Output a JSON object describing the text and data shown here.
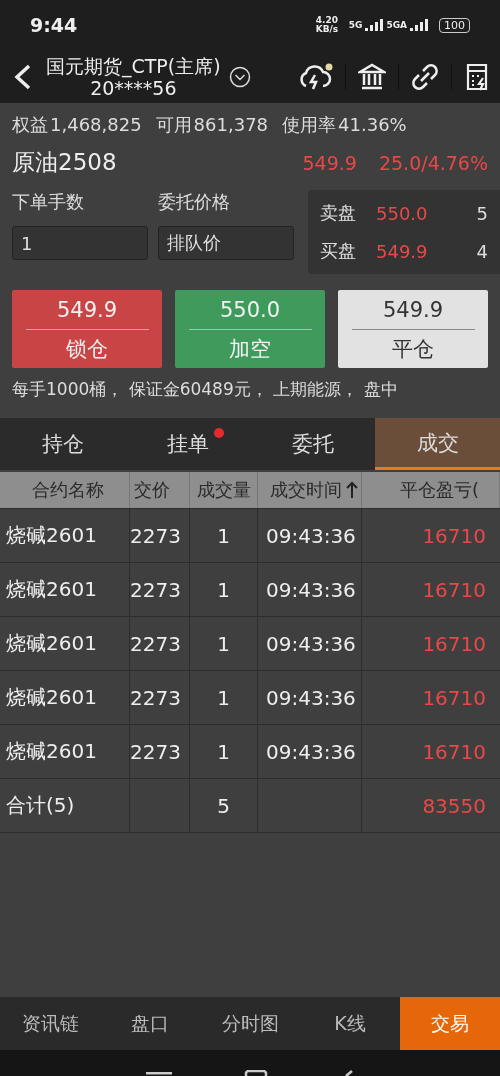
{
  "status_bar": {
    "time": "9:44",
    "speed": "4.20 KB/s",
    "network_1": "5G",
    "network_2": "5GA",
    "battery": "100"
  },
  "header": {
    "title": "国元期货_CTP(主席)",
    "account": "20****56"
  },
  "account": {
    "equity_label": "权益",
    "equity": "1,468,825",
    "available_label": "可用",
    "available": "861,378",
    "usage_label": "使用率",
    "usage": "41.36%"
  },
  "instrument": {
    "name": "原油2508",
    "price": "549.9",
    "change": "25.0/4.76%"
  },
  "order": {
    "lots_label": "下单手数",
    "lots": "1",
    "price_label": "委托价格",
    "price_type": "排队价"
  },
  "book": [
    {
      "side": "卖盘",
      "price": "550.0",
      "volume": "5"
    },
    {
      "side": "买盘",
      "price": "549.9",
      "volume": "4"
    }
  ],
  "actions": [
    {
      "kind": "red",
      "price": "549.9",
      "label": "锁仓"
    },
    {
      "kind": "green",
      "price": "550.0",
      "label": "加空"
    },
    {
      "kind": "light",
      "price": "549.9",
      "label": "平仓"
    }
  ],
  "contract_info": "每手1000桶， 保证金60489元， 上期能源， 盘中",
  "tabs": [
    {
      "label": "持仓",
      "selected": false,
      "badge": false
    },
    {
      "label": "挂单",
      "selected": false,
      "badge": true
    },
    {
      "label": "委托",
      "selected": false,
      "badge": false
    },
    {
      "label": "成交",
      "selected": true,
      "badge": false
    }
  ],
  "table": {
    "columns": [
      {
        "label": "合约名称",
        "sorted": false
      },
      {
        "label": "交价",
        "sorted": false
      },
      {
        "label": "成交量",
        "sorted": false
      },
      {
        "label": "成交时间",
        "sorted": true
      },
      {
        "label": "平仓盈亏(",
        "sorted": false
      }
    ],
    "rows": [
      [
        "烧碱2601",
        "2273",
        "1",
        "09:43:36",
        "16710"
      ],
      [
        "烧碱2601",
        "2273",
        "1",
        "09:43:36",
        "16710"
      ],
      [
        "烧碱2601",
        "2273",
        "1",
        "09:43:36",
        "16710"
      ],
      [
        "烧碱2601",
        "2273",
        "1",
        "09:43:36",
        "16710"
      ],
      [
        "烧碱2601",
        "2273",
        "1",
        "09:43:36",
        "16710"
      ]
    ],
    "total": {
      "label": "合计(5)",
      "volume": "5",
      "profit": "83550"
    }
  },
  "bottom_nav": [
    {
      "label": "资讯链",
      "selected": false
    },
    {
      "label": "盘口",
      "selected": false
    },
    {
      "label": "分时图",
      "selected": false
    },
    {
      "label": "K线",
      "selected": false
    },
    {
      "label": "交易",
      "selected": true
    }
  ]
}
